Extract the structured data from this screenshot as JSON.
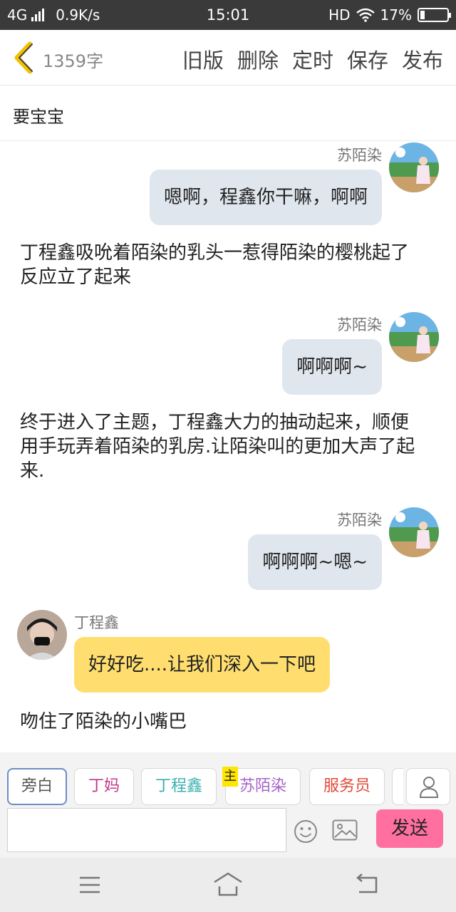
{
  "status_bar": {
    "network": "4G",
    "speed": "0.9K/s",
    "time": "15:01",
    "hd": "HD",
    "battery_percent": "17%",
    "battery_level": 0.17
  },
  "header": {
    "word_count": "1359字",
    "actions": [
      "旧版",
      "删除",
      "定时",
      "保存",
      "发布"
    ]
  },
  "story_title": "要宝宝",
  "chat": {
    "messages": [
      {
        "speaker": "苏陌染",
        "text": "嗯啊，程鑫你干嘛，啊啊"
      },
      {
        "narration": "丁程鑫吸吮着陌染的乳头一惹得陌染的樱桃起了反应立了起来"
      },
      {
        "speaker": "苏陌染",
        "text": "啊啊啊~"
      },
      {
        "narration": "终于进入了主题，丁程鑫大力的抽动起来，顺便用手玩弄着陌染的乳房.让陌染叫的更加大声了起来."
      },
      {
        "speaker": "苏陌染",
        "text": "啊啊啊~嗯~"
      },
      {
        "speaker": "丁程鑫",
        "text": "好好吃....让我们深入一下吧"
      },
      {
        "narration": "吻住了陌染的小嘴巴"
      }
    ]
  },
  "roles": {
    "tabs": [
      {
        "label": "旁白",
        "color": "#555555"
      },
      {
        "label": "丁妈",
        "color": "#c0398a"
      },
      {
        "label": "丁程鑫",
        "color": "#3bb0b0"
      },
      {
        "label": "苏陌染",
        "color": "#a565c8"
      },
      {
        "label": "服务员",
        "color": "#e04a3a"
      }
    ],
    "main_badge": "主"
  },
  "composer": {
    "send_label": "发送"
  },
  "colors": {
    "bubble_self": "#dfe6ee",
    "bubble_other": "#ffde6f",
    "send_button": "#ff6fa0",
    "back_arrow": "#f2c200"
  }
}
